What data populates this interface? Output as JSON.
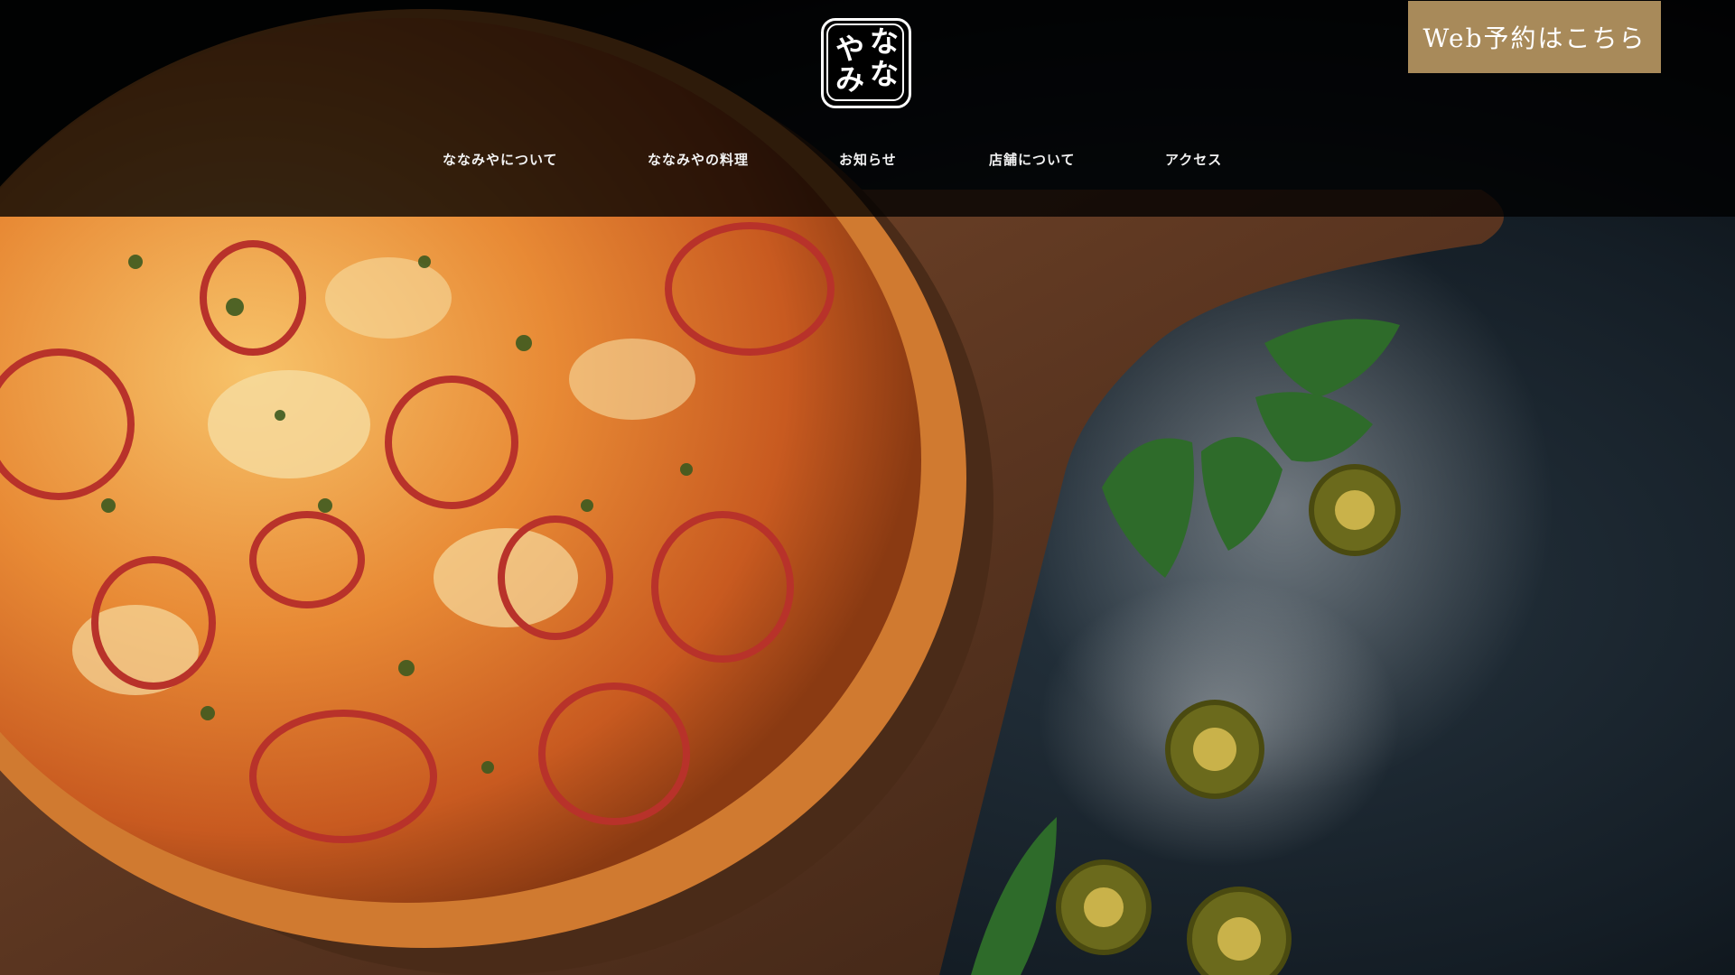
{
  "logo": {
    "glyphs": [
      "な",
      "な",
      "や",
      "み"
    ],
    "alt": "ななみや"
  },
  "header": {
    "reserve_label": "Web予約はこちら"
  },
  "nav": {
    "items": [
      {
        "label": "ななみやについて"
      },
      {
        "label": "ななみやの料理"
      },
      {
        "label": "お知らせ"
      },
      {
        "label": "店舗について"
      },
      {
        "label": "アクセス"
      }
    ]
  },
  "colors": {
    "header_bg": "#000000",
    "reserve_bg": "#a88a5a",
    "text": "#ffffff"
  }
}
